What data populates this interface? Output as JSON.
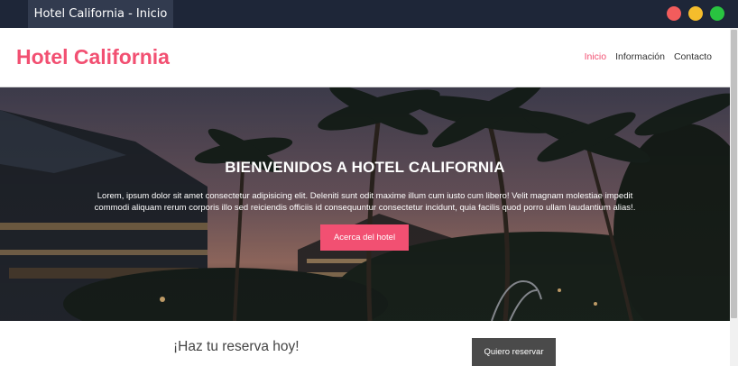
{
  "window": {
    "tab_title": "Hotel California - Inicio",
    "controls": {
      "close_color": "#f25c5c",
      "minimize_color": "#f5bd2c",
      "maximize_color": "#29c440"
    }
  },
  "header": {
    "brand": "Hotel California",
    "nav": [
      {
        "label": "Inicio",
        "active": true
      },
      {
        "label": "Información",
        "active": false
      },
      {
        "label": "Contacto",
        "active": false
      }
    ]
  },
  "hero": {
    "title": "BIENVENIDOS A HOTEL CALIFORNIA",
    "text": "Lorem, ipsum dolor sit amet consectetur adipisicing elit. Deleniti sunt odit maxime illum cum iusto cum libero! Velit magnam molestiae impedit commodi aliquam rerum corporis illo sed reiciendis officiis id consequuntur consectetur incidunt, quia facilis quod porro ullam laudantium alias!.",
    "button": "Acerca del hotel"
  },
  "booking": {
    "text": "¡Haz tu reserva hoy!",
    "button": "Quiero reservar"
  },
  "colors": {
    "accent": "#f25072",
    "dark_button": "#4a4a4a"
  }
}
